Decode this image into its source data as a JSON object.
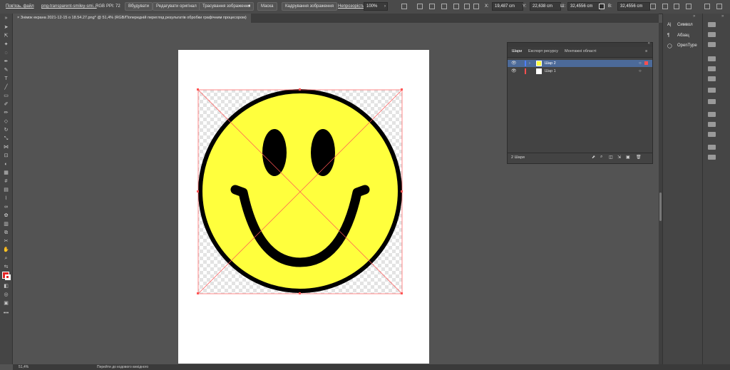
{
  "control_bar": {
    "link_file": "Пов'язь. файл",
    "file_name": "png-transparent-smiley-smi...",
    "color_mode": "RGB",
    "ppi": "PPI: 72",
    "embed_btn": "Вбудувати",
    "edit_original_btn": "Редагувати оригінал",
    "trace_btn": "Трасування зображення",
    "mask_btn": "Маска",
    "crop_btn": "Кадрування зображення",
    "opacity_label": "Непрозорість:",
    "opacity_value": "100%",
    "x_label": "X:",
    "x_value": "19,487 cm",
    "y_label": "Y:",
    "y_value": "22,638 cm",
    "w_label": "Ш:",
    "w_value": "32,4556 cm",
    "h_label": "В:",
    "h_value": "32,4556 cm"
  },
  "document_tab": {
    "title": "Знімок екрана 2021-12-15 о 18.54.27.png* @ 51,4% (RGB/Попередній перегляд результатів обробки графічним процесором)",
    "close": "×"
  },
  "right_dock": {
    "items": [
      "Символ",
      "Абзац",
      "OpenType"
    ]
  },
  "layers_panel": {
    "tabs": [
      "Шари",
      "Експорт ресурсу",
      "Монтажні області"
    ],
    "layers": [
      {
        "name": "Шар 2",
        "color": "#4f7fff",
        "selected": true
      },
      {
        "name": "Шар 1",
        "color": "#ff4f4f",
        "selected": false
      }
    ],
    "footer_count": "2 Шари"
  },
  "status_bar": {
    "zoom": "51,4%",
    "message": "Перейти до кодового вихідного"
  },
  "colors": {
    "accent_selection": "#4c6a99",
    "smiley_fill": "#ffff3d",
    "bounding_box": "#ff5555",
    "fill_swatch": "#e32626"
  }
}
